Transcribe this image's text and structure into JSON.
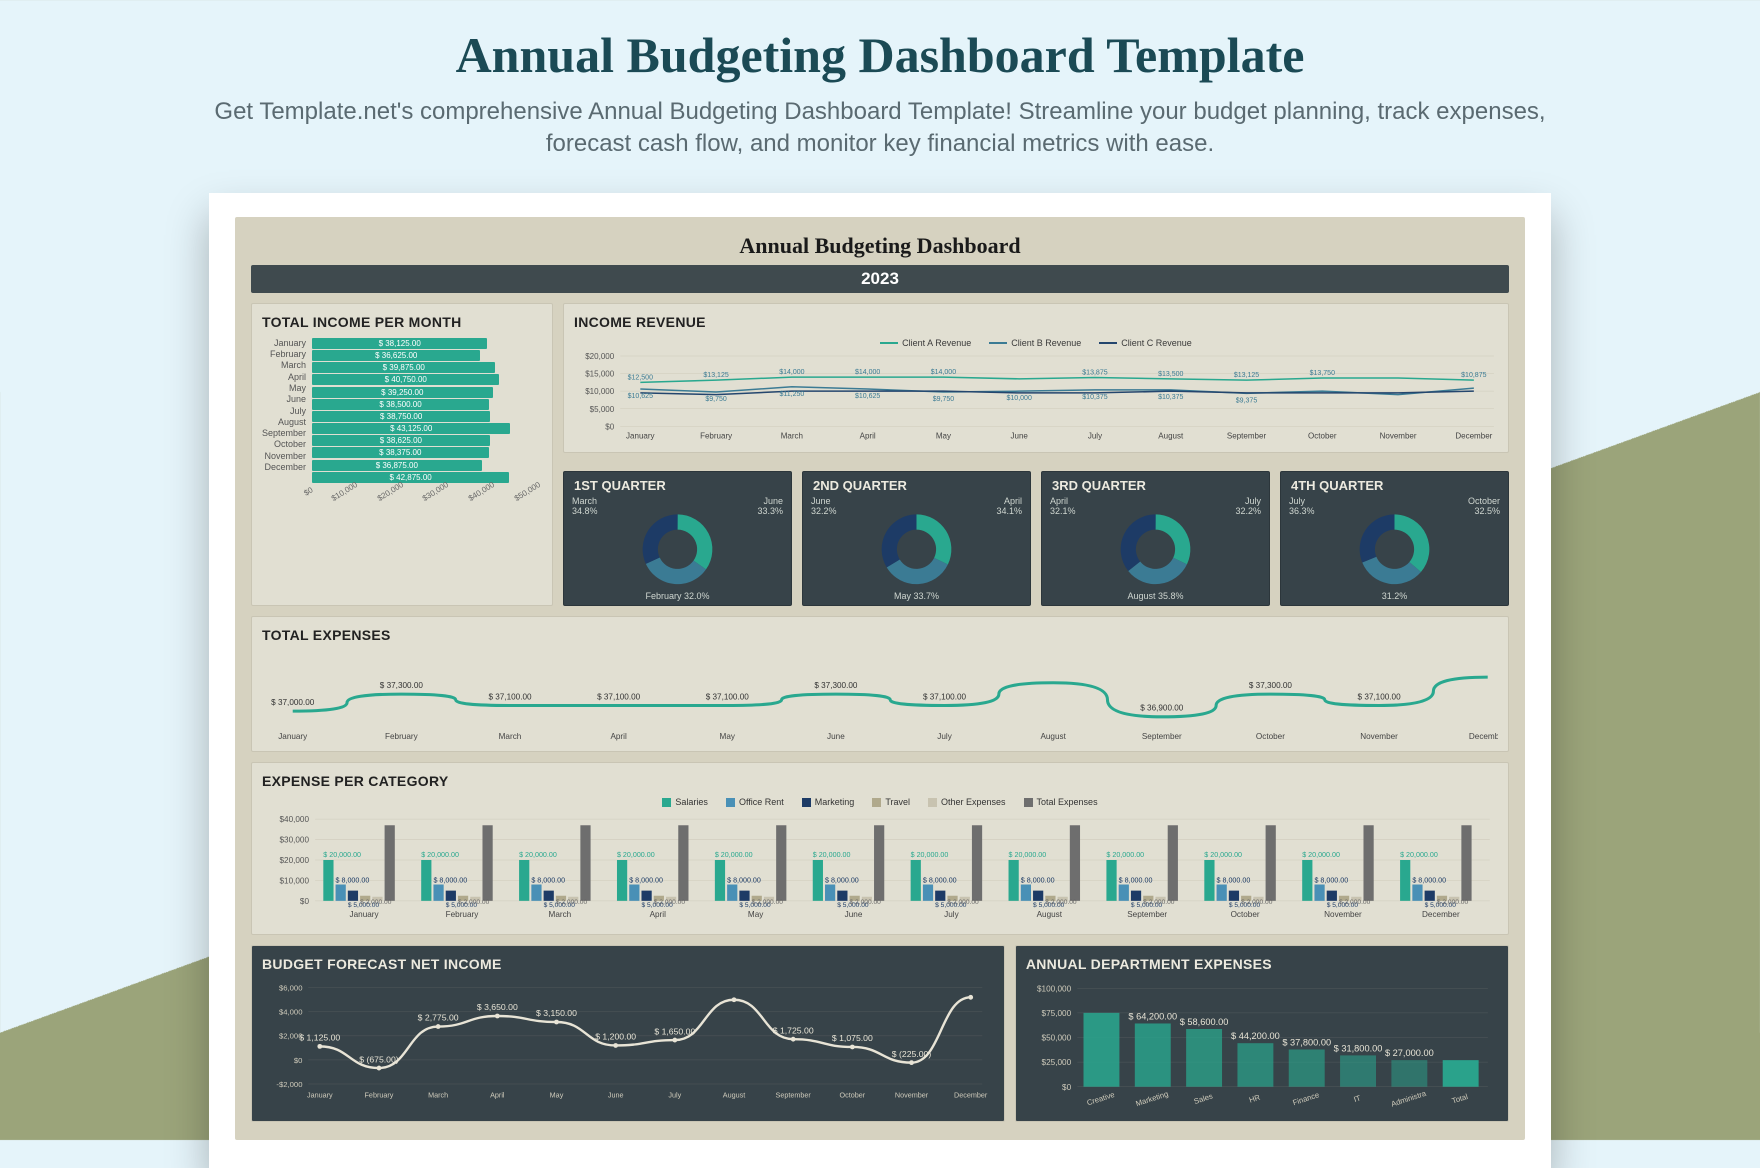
{
  "header": {
    "title": "Annual Budgeting Dashboard Template",
    "subtitle": "Get Template.net's comprehensive Annual Budgeting Dashboard Template! Streamline your budget planning, track expenses, forecast cash flow, and monitor key financial metrics with ease."
  },
  "dashboard": {
    "title": "Annual Budgeting Dashboard",
    "year": "2023"
  },
  "months": [
    "January",
    "February",
    "March",
    "April",
    "May",
    "June",
    "July",
    "August",
    "September",
    "October",
    "November",
    "December"
  ],
  "total_income_per_month": {
    "title": "TOTAL INCOME PER MONTH",
    "values": [
      38125,
      36625,
      39875,
      40750,
      39250,
      38500,
      38750,
      43125,
      38625,
      38375,
      36875,
      42875
    ],
    "labels": [
      "$ 38,125.00",
      "$ 36,625.00",
      "$ 39,875.00",
      "$ 40,750.00",
      "$ 39,250.00",
      "$ 38,500.00",
      "$ 38,750.00",
      "$ 43,125.00",
      "$ 38,625.00",
      "$ 38,375.00",
      "$ 36,875.00",
      "$ 42,875.00"
    ],
    "axis": [
      "$0",
      "$10,000",
      "$20,000",
      "$30,000",
      "$40,000",
      "$50,000"
    ]
  },
  "income_revenue": {
    "title": "INCOME REVENUE",
    "legend": [
      "Client A Revenue",
      "Client B Revenue",
      "Client C Revenue"
    ],
    "y_ticks": [
      "$0",
      "$5,000",
      "$10,000",
      "$15,000",
      "$20,000"
    ],
    "series": {
      "a": [
        12500,
        13125,
        14000,
        14000,
        14000,
        13500,
        13875,
        13500,
        13125,
        13750,
        13750,
        13125
      ],
      "b": [
        10625,
        9750,
        11250,
        10625,
        9750,
        10000,
        10375,
        10375,
        9375,
        10000,
        9000,
        10875
      ],
      "c": [
        9500,
        9000,
        10000,
        10000,
        10000,
        9500,
        9500,
        10000,
        9500,
        9500,
        9500,
        10000
      ]
    },
    "data_labels_top": [
      "$12,500",
      "$13,125",
      "$14,000",
      "$14,000",
      "$14,000",
      "",
      "$13,875",
      "$13,500",
      "$13,125",
      "$13,750",
      "",
      "$10,875"
    ],
    "data_labels_bottom": [
      "$10,625",
      "$9,750",
      "$11,250",
      "$10,625",
      "$9,750",
      "$10,000",
      "$10,375",
      "$10,375",
      "$9,375",
      "",
      "",
      ""
    ]
  },
  "quarters": [
    {
      "title": "1ST QUARTER",
      "slices": [
        34.8,
        33.3,
        32.0
      ],
      "labels": [
        "March",
        "June",
        "February"
      ],
      "pct": [
        "34.8%",
        "33.3%",
        "32.0%"
      ]
    },
    {
      "title": "2ND QUARTER",
      "slices": [
        32.2,
        34.1,
        33.7
      ],
      "labels": [
        "June",
        "April",
        "May"
      ],
      "pct": [
        "32.2%",
        "34.1%",
        "33.7%"
      ]
    },
    {
      "title": "3RD QUARTER",
      "slices": [
        32.1,
        32.2,
        35.8
      ],
      "labels": [
        "April",
        "July",
        "August"
      ],
      "pct": [
        "32.1%",
        "32.2%",
        "35.8%"
      ]
    },
    {
      "title": "4TH QUARTER",
      "slices": [
        36.3,
        32.5,
        31.2
      ],
      "labels": [
        "July",
        "October",
        ""
      ],
      "pct": [
        "36.3%",
        "32.5%",
        "31.2%"
      ]
    }
  ],
  "total_expenses": {
    "title": "TOTAL EXPENSES",
    "values": [
      37000,
      37300,
      37100,
      37100,
      37100,
      37300,
      37100,
      37500,
      36900,
      37300,
      37100,
      37600
    ],
    "labels": [
      "$ 37,000.00",
      "$ 37,300.00",
      "$ 37,100.00",
      "$ 37,100.00",
      "$ 37,100.00",
      "$ 37,300.00",
      "$ 37,100.00",
      "",
      "$ 36,900.00",
      "$ 37,300.00",
      "$ 37,100.00",
      ""
    ]
  },
  "expense_per_category": {
    "title": "EXPENSE PER CATEGORY",
    "legend": [
      "Salaries",
      "Office Rent",
      "Marketing",
      "Travel",
      "Other Expenses",
      "Total Expenses"
    ],
    "colors": [
      "#29a88f",
      "#4990b6",
      "#1d3b66",
      "#b0a98c",
      "#c8c3b0",
      "#6e6e6e"
    ],
    "y_ticks": [
      "$0",
      "$10,000",
      "$20,000",
      "$30,000",
      "$40,000"
    ],
    "salaries": 20000,
    "office_rent": 8000,
    "marketing": 5000,
    "travel": 2500,
    "other": 2000,
    "total": 37000
  },
  "budget_forecast": {
    "title": "BUDGET FORECAST NET INCOME",
    "y_ticks": [
      "-$2,000",
      "$0",
      "$2,000",
      "$4,000",
      "$6,000"
    ],
    "values": [
      1125,
      -675,
      2775,
      3650,
      3150,
      1200,
      1650,
      5000,
      1725,
      1075,
      -225,
      5200
    ],
    "labels": [
      "$ 1,125.00",
      "$ (675.00)",
      "$ 2,775.00",
      "$ 3,650.00",
      "$ 3,150.00",
      "$ 1,200.00",
      "$ 1,650.00",
      "",
      "$ 1,725.00",
      "$ 1,075.00",
      "$ (225.00)",
      ""
    ]
  },
  "department_expenses": {
    "title": "ANNUAL DEPARTMENT EXPENSES",
    "y_ticks": [
      "$0",
      "$25,000",
      "$50,000",
      "$75,000",
      "$100,000"
    ],
    "categories": [
      "Creative",
      "Marketing",
      "Sales",
      "HR",
      "Finance",
      "IT",
      "Administra",
      "Total"
    ],
    "values": [
      75000,
      64200,
      58600,
      44200,
      37800,
      31800,
      27000,
      27000
    ],
    "labels": [
      "",
      "$ 64,200.00",
      "$ 58,600.00",
      "$ 44,200.00",
      "$ 37,800.00",
      "$ 31,800.00",
      "$ 27,000.00",
      ""
    ]
  },
  "chart_data": [
    {
      "type": "bar",
      "title": "Total Income Per Month",
      "categories": [
        "January",
        "February",
        "March",
        "April",
        "May",
        "June",
        "July",
        "August",
        "September",
        "October",
        "November",
        "December"
      ],
      "values": [
        38125,
        36625,
        39875,
        40750,
        39250,
        38500,
        38750,
        43125,
        38625,
        38375,
        36875,
        42875
      ],
      "xlabel": "",
      "ylabel": "",
      "ylim": [
        0,
        50000
      ]
    },
    {
      "type": "line",
      "title": "Income Revenue",
      "categories": [
        "January",
        "February",
        "March",
        "April",
        "May",
        "June",
        "July",
        "August",
        "September",
        "October",
        "November",
        "December"
      ],
      "series": [
        {
          "name": "Client A Revenue",
          "values": [
            12500,
            13125,
            14000,
            14000,
            14000,
            13500,
            13875,
            13500,
            13125,
            13750,
            13750,
            13125
          ]
        },
        {
          "name": "Client B Revenue",
          "values": [
            10625,
            9750,
            11250,
            10625,
            9750,
            10000,
            10375,
            10375,
            9375,
            10000,
            9000,
            10875
          ]
        },
        {
          "name": "Client C Revenue",
          "values": [
            9500,
            9000,
            10000,
            10000,
            10000,
            9500,
            9500,
            10000,
            9500,
            9500,
            9500,
            10000
          ]
        }
      ],
      "ylim": [
        0,
        20000
      ]
    },
    {
      "type": "pie",
      "title": "1st Quarter",
      "categories": [
        "March",
        "June",
        "February"
      ],
      "values": [
        34.8,
        33.3,
        32.0
      ]
    },
    {
      "type": "pie",
      "title": "2nd Quarter",
      "categories": [
        "June",
        "April",
        "May"
      ],
      "values": [
        32.2,
        34.1,
        33.7
      ]
    },
    {
      "type": "pie",
      "title": "3rd Quarter",
      "categories": [
        "April",
        "July",
        "August"
      ],
      "values": [
        32.1,
        32.2,
        35.8
      ]
    },
    {
      "type": "pie",
      "title": "4th Quarter",
      "categories": [
        "July",
        "October",
        ""
      ],
      "values": [
        36.3,
        32.5,
        31.2
      ]
    },
    {
      "type": "line",
      "title": "Total Expenses",
      "categories": [
        "January",
        "February",
        "March",
        "April",
        "May",
        "June",
        "July",
        "August",
        "September",
        "October",
        "November",
        "December"
      ],
      "values": [
        37000,
        37300,
        37100,
        37100,
        37100,
        37300,
        37100,
        37500,
        36900,
        37300,
        37100,
        37600
      ],
      "ylim": [
        36800,
        37700
      ]
    },
    {
      "type": "bar",
      "title": "Expense Per Category",
      "categories": [
        "January",
        "February",
        "March",
        "April",
        "May",
        "June",
        "July",
        "August",
        "September",
        "October",
        "November",
        "December"
      ],
      "series": [
        {
          "name": "Salaries",
          "values": [
            20000,
            20000,
            20000,
            20000,
            20000,
            20000,
            20000,
            20000,
            20000,
            20000,
            20000,
            20000
          ]
        },
        {
          "name": "Office Rent",
          "values": [
            8000,
            8000,
            8000,
            8000,
            8000,
            8000,
            8000,
            8000,
            8000,
            8000,
            8000,
            8000
          ]
        },
        {
          "name": "Marketing",
          "values": [
            5000,
            5000,
            5000,
            5000,
            5000,
            5000,
            5000,
            5000,
            5000,
            5000,
            5000,
            5000
          ]
        },
        {
          "name": "Travel",
          "values": [
            2500,
            2500,
            2500,
            2500,
            2500,
            2500,
            2500,
            2500,
            2500,
            2500,
            2500,
            2500
          ]
        },
        {
          "name": "Other Expenses",
          "values": [
            2000,
            2000,
            2000,
            2000,
            2000,
            2000,
            2000,
            2000,
            2000,
            2000,
            2000,
            2000
          ]
        },
        {
          "name": "Total Expenses",
          "values": [
            37000,
            37300,
            37100,
            37100,
            37100,
            37300,
            37100,
            37500,
            36900,
            37300,
            37100,
            37600
          ]
        }
      ],
      "ylim": [
        0,
        40000
      ]
    },
    {
      "type": "line",
      "title": "Budget Forecast Net Income",
      "categories": [
        "January",
        "February",
        "March",
        "April",
        "May",
        "June",
        "July",
        "August",
        "September",
        "October",
        "November",
        "December"
      ],
      "values": [
        1125,
        -675,
        2775,
        3650,
        3150,
        1200,
        1650,
        5000,
        1725,
        1075,
        -225,
        5200
      ],
      "ylim": [
        -2000,
        6000
      ]
    },
    {
      "type": "bar",
      "title": "Annual Department Expenses",
      "categories": [
        "Creative",
        "Marketing",
        "Sales",
        "HR",
        "Finance",
        "IT",
        "Administra",
        "Total"
      ],
      "values": [
        75000,
        64200,
        58600,
        44200,
        37800,
        31800,
        27000,
        27000
      ],
      "ylim": [
        0,
        100000
      ]
    }
  ]
}
